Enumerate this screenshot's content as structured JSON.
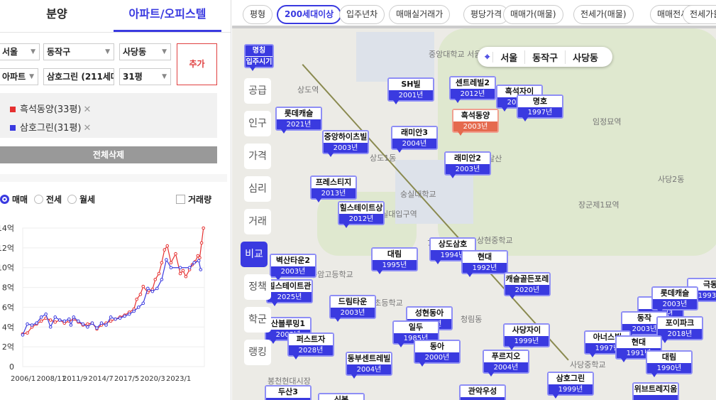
{
  "tabs": [
    "분양",
    "아파트/오피스텔"
  ],
  "selects": {
    "city": "서울",
    "gu": "동작구",
    "dong": "사당동",
    "type": "아파트",
    "complex": "삼호그린 (211세대)",
    "size": "31평"
  },
  "add_label": "추가",
  "compare": [
    {
      "label": "흑석동양(33평)",
      "color": "#e53030"
    },
    {
      "label": "삼호그린(31평)",
      "color": "#3a3ae0"
    }
  ],
  "delete_all": "전체삭제",
  "radios": [
    "매매",
    "전세",
    "월세"
  ],
  "volume_label": "거래량",
  "filters": [
    "평형",
    "200세대이상",
    "입주년차",
    "매매실거래가",
    "평당가격",
    "매매가(매물)",
    "전세가(매물)",
    "매매전세갭",
    "전세가율"
  ],
  "location": [
    "서울",
    "동작구",
    "사당동"
  ],
  "side_menu": [
    "공급",
    "인구",
    "가격",
    "심리",
    "거래",
    "비교",
    "정책",
    "학군",
    "랭킹"
  ],
  "legend_marker": {
    "name": "명칭",
    "year": "입주시기"
  },
  "map_labels": [
    "상도역",
    "숭실대입구역",
    "상도1동",
    "사당2동",
    "청림동",
    "숭실대학교",
    "중앙대학교 서울캠퍼스",
    "임정묘역",
    "장군제1묘역",
    "서달산",
    "구암고등학교",
    "봉현초등학교",
    "상현중학교",
    "사당중학교",
    "봉천현대시장",
    "7호선"
  ],
  "markers": [
    {
      "name": "SH빌",
      "year": "2001년"
    },
    {
      "name": "센트레빌2",
      "year": "2012년"
    },
    {
      "name": "흑석자이",
      "year": "2023년"
    },
    {
      "name": "명호",
      "year": "1997년"
    },
    {
      "name": "롯데캐슬",
      "year": "2021년"
    },
    {
      "name": "중앙하이츠빌",
      "year": "2003년"
    },
    {
      "name": "래미안3",
      "year": "2004년"
    },
    {
      "name": "래미안2",
      "year": "2003년"
    },
    {
      "name": "프레스티지",
      "year": "2013년"
    },
    {
      "name": "힐스테이트상",
      "year": "2012년"
    },
    {
      "name": "대림",
      "year": "1995년"
    },
    {
      "name": "상도삼호",
      "year": "1994년"
    },
    {
      "name": "현대",
      "year": "1992년"
    },
    {
      "name": "캐슬골든포레",
      "year": "2020년"
    },
    {
      "name": "벽산타운2",
      "year": "2003년"
    },
    {
      "name": "힐스테이트관",
      "year": "2025년"
    },
    {
      "name": "드림타운",
      "year": "2003년"
    },
    {
      "name": "성현동아",
      "year": "2000년"
    },
    {
      "name": "일두",
      "year": "1985년"
    },
    {
      "name": "동아",
      "year": "2000년"
    },
    {
      "name": "산블루밍1",
      "year": "2003년"
    },
    {
      "name": "퍼스트자",
      "year": "2028년"
    },
    {
      "name": "동부센트레빌",
      "year": "2004년"
    },
    {
      "name": "두산3",
      "year": ""
    },
    {
      "name": "신봉",
      "year": ""
    },
    {
      "name": "관악우성",
      "year": ""
    },
    {
      "name": "사당자이",
      "year": "1999년"
    },
    {
      "name": "푸르지오",
      "year": "2004년"
    },
    {
      "name": "삼호그린",
      "year": "1999년"
    },
    {
      "name": "극동",
      "year": "1993년"
    },
    {
      "name": "롯",
      "year": "2004년"
    },
    {
      "name": "롯데캐슬",
      "year": "2003년"
    },
    {
      "name": "동작",
      "year": "2003년"
    },
    {
      "name": "포이파크",
      "year": "2018년"
    },
    {
      "name": "아너스빌",
      "year": "1997년"
    },
    {
      "name": "현대",
      "year": "1991년"
    },
    {
      "name": "대림",
      "year": "1990년"
    },
    {
      "name": "위브트레지움",
      "year": ""
    },
    {
      "name": "흑석동양",
      "year": "2003년",
      "highlight": true
    }
  ],
  "chart_data": {
    "type": "line",
    "xlabel": "",
    "ylabel": "",
    "ylim": [
      0,
      14
    ],
    "xlim": [
      2006,
      2025.6
    ],
    "yticks": [
      "0",
      "2억",
      "4억",
      "6억",
      "8억",
      "10억",
      "12억",
      "14억"
    ],
    "xticks": [
      "2006/1",
      "2008/11",
      "2011/9",
      "2014/7",
      "2017/5",
      "2020/3",
      "2023/1"
    ],
    "series": [
      {
        "name": "흑석동양(33평)",
        "color": "#e53030",
        "x": [
          2006.0,
          2006.5,
          2007.0,
          2007.5,
          2008.0,
          2008.5,
          2009.0,
          2009.5,
          2010.0,
          2010.5,
          2011.0,
          2011.5,
          2012.0,
          2012.5,
          2013.0,
          2013.5,
          2014.0,
          2014.5,
          2015.0,
          2015.5,
          2016.0,
          2016.5,
          2017.0,
          2017.5,
          2018.0,
          2018.3,
          2018.7,
          2019.0,
          2019.5,
          2020.0,
          2020.3,
          2020.7,
          2021.0,
          2021.3,
          2021.6,
          2022.0,
          2022.5,
          2023.0,
          2023.3,
          2023.6,
          2024.0,
          2024.3,
          2024.6,
          2024.9,
          2025.1,
          2025.3,
          2025.5
        ],
        "y": [
          3.3,
          3.4,
          4.0,
          4.3,
          4.6,
          4.9,
          4.7,
          4.5,
          4.7,
          4.4,
          4.6,
          4.8,
          4.5,
          4.2,
          4.3,
          4.4,
          3.8,
          4.2,
          4.4,
          4.6,
          4.8,
          5.0,
          5.2,
          5.5,
          5.8,
          6.8,
          7.3,
          8.1,
          7.5,
          7.8,
          8.8,
          9.4,
          10.5,
          11.8,
          12.2,
          10.5,
          11.4,
          9.4,
          9.7,
          9.1,
          9.8,
          10.3,
          10.6,
          11.2,
          11.0,
          12.5,
          14.0
        ]
      },
      {
        "name": "삼호그린(31평)",
        "color": "#3a3ae0",
        "x": [
          2006.0,
          2006.5,
          2007.0,
          2007.5,
          2008.0,
          2008.5,
          2009.0,
          2009.5,
          2010.0,
          2010.5,
          2011.0,
          2011.2,
          2011.5,
          2012.0,
          2012.5,
          2013.0,
          2013.5,
          2014.0,
          2014.5,
          2015.0,
          2015.5,
          2016.0,
          2016.5,
          2017.0,
          2017.5,
          2018.0,
          2018.5,
          2019.0,
          2019.5,
          2020.0,
          2020.5,
          2021.0,
          2021.5,
          2022.0,
          2023.0,
          2024.0,
          2024.5,
          2025.0,
          2025.2
        ],
        "y": [
          3.2,
          4.3,
          4.2,
          4.4,
          5.0,
          5.3,
          4.0,
          5.0,
          4.7,
          4.6,
          4.8,
          4.2,
          5.0,
          4.6,
          4.3,
          4.0,
          4.4,
          3.9,
          4.4,
          4.2,
          5.0,
          4.8,
          4.9,
          5.1,
          5.3,
          5.6,
          6.0,
          6.4,
          7.9,
          7.6,
          7.9,
          8.8,
          10.8,
          10.0,
          10.0,
          10.0,
          10.5,
          10.7,
          9.8
        ]
      }
    ]
  }
}
